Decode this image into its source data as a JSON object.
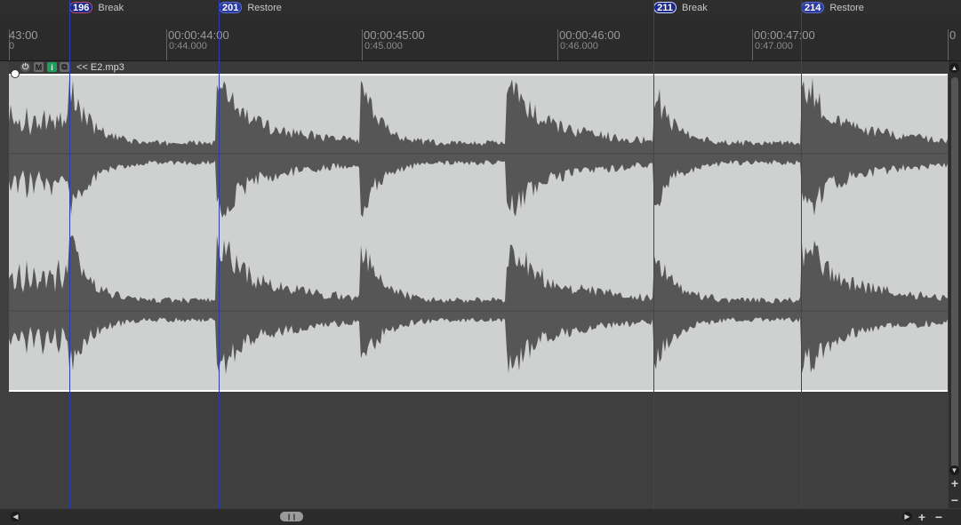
{
  "markers": [
    {
      "id": "196",
      "label": "Break",
      "style": "break"
    },
    {
      "id": "201",
      "label": "Restore",
      "style": "restore"
    },
    {
      "id": "211",
      "label": "Break",
      "style": "break2"
    },
    {
      "id": "214",
      "label": "Restore",
      "style": "restore"
    }
  ],
  "ruler": {
    "ticks": [
      {
        "main": "43:00",
        "sub": "0"
      },
      {
        "main": "00:00:44:00",
        "sub": "0:44.000"
      },
      {
        "main": "00:00:45:00",
        "sub": "0:45.000"
      },
      {
        "main": "00:00:46:00",
        "sub": "0:46.000"
      },
      {
        "main": "00:00:47:00",
        "sub": "0:47.000"
      },
      {
        "main": "0",
        "sub": ""
      }
    ]
  },
  "track": {
    "name": "<< E2.mp3",
    "buttons": {
      "power": "⏻",
      "mute": "M",
      "info": "i",
      "fx": "⧉"
    }
  },
  "scrollbar": {
    "up": "▲",
    "down": "▼",
    "zoom_in": "+",
    "zoom_out": "−",
    "left": "◀",
    "right": "▶",
    "handle": "❙❙"
  },
  "colors": {
    "waveform": "#565656",
    "waveform_bg": "#cfd0d0",
    "marker_line": "#2a3cb8"
  }
}
